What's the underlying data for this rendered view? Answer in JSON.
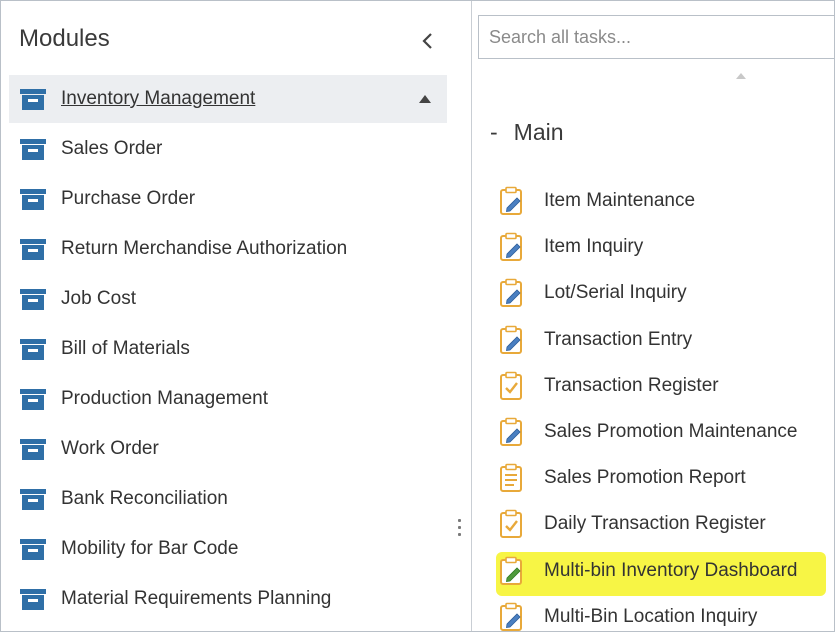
{
  "modules": {
    "title": "Modules",
    "collapse_icon": "chevron-left-icon",
    "items": [
      {
        "label": "Inventory Management",
        "selected": true
      },
      {
        "label": "Sales Order"
      },
      {
        "label": "Purchase Order"
      },
      {
        "label": "Return Merchandise Authorization"
      },
      {
        "label": "Job Cost"
      },
      {
        "label": "Bill of Materials"
      },
      {
        "label": "Production Management"
      },
      {
        "label": "Work Order"
      },
      {
        "label": "Bank Reconciliation"
      },
      {
        "label": "Mobility for Bar Code"
      },
      {
        "label": "Material Requirements Planning"
      }
    ]
  },
  "tasks": {
    "search_placeholder": "Search all tasks...",
    "group": {
      "dash": "-",
      "title": "Main"
    },
    "items": [
      {
        "label": "Item Maintenance",
        "icon": "clipboard-edit-icon"
      },
      {
        "label": "Item Inquiry",
        "icon": "clipboard-edit-icon"
      },
      {
        "label": "Lot/Serial Inquiry",
        "icon": "clipboard-edit-icon"
      },
      {
        "label": "Transaction Entry",
        "icon": "clipboard-edit-icon"
      },
      {
        "label": "Transaction Register",
        "icon": "clipboard-check-icon"
      },
      {
        "label": "Sales Promotion Maintenance",
        "icon": "clipboard-edit-icon"
      },
      {
        "label": "Sales Promotion Report",
        "icon": "clipboard-report-icon"
      },
      {
        "label": "Daily Transaction Register",
        "icon": "clipboard-check-icon"
      },
      {
        "label": "Multi-bin Inventory Dashboard",
        "icon": "clipboard-dashboard-icon",
        "highlighted": true
      },
      {
        "label": "Multi-Bin Location Inquiry",
        "icon": "clipboard-edit-icon"
      }
    ]
  },
  "colors": {
    "highlight": "#f7f545",
    "module_icon": "#2f6fa7",
    "task_icon": "#e8a93a",
    "selected_row": "#eceef1"
  }
}
